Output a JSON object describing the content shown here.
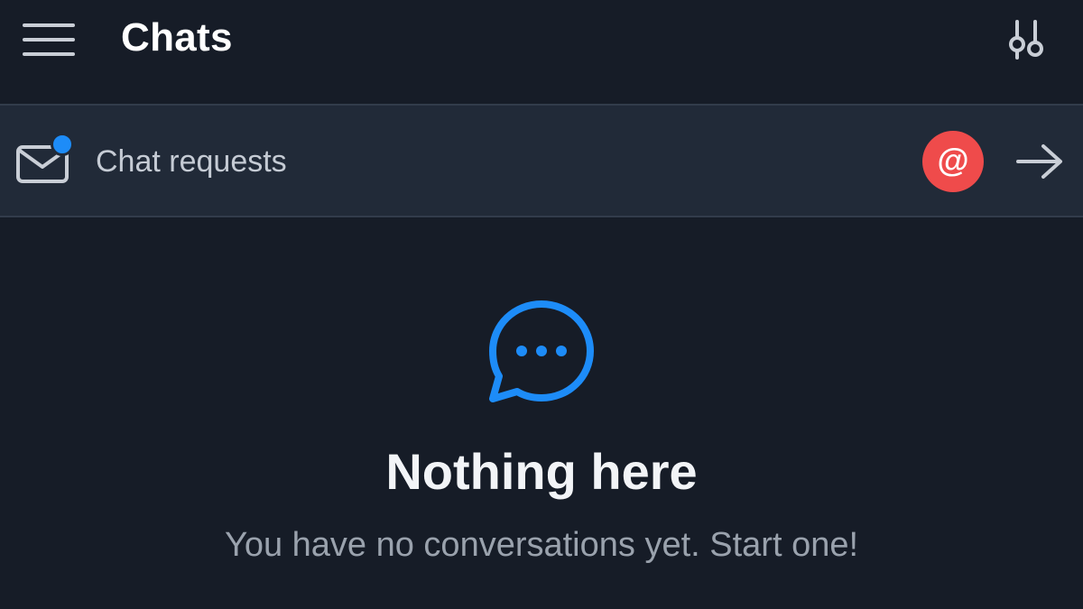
{
  "header": {
    "title": "Chats",
    "menu_icon": "hamburger-menu-icon",
    "filter_icon": "sliders-filter-icon"
  },
  "chat_requests": {
    "label": "Chat requests",
    "icon": "mail-icon",
    "has_unread": true,
    "badge_symbol": "@",
    "badge_color": "#ef4b4b",
    "dot_color": "#1d8cf8",
    "arrow_icon": "arrow-right-icon"
  },
  "empty_state": {
    "icon": "chat-bubble-icon",
    "icon_color": "#1d8cf8",
    "title": "Nothing here",
    "subtitle": "You have no conversations yet. Start one!"
  },
  "colors": {
    "background": "#161c27",
    "row_background": "#212a38",
    "accent": "#1d8cf8"
  }
}
